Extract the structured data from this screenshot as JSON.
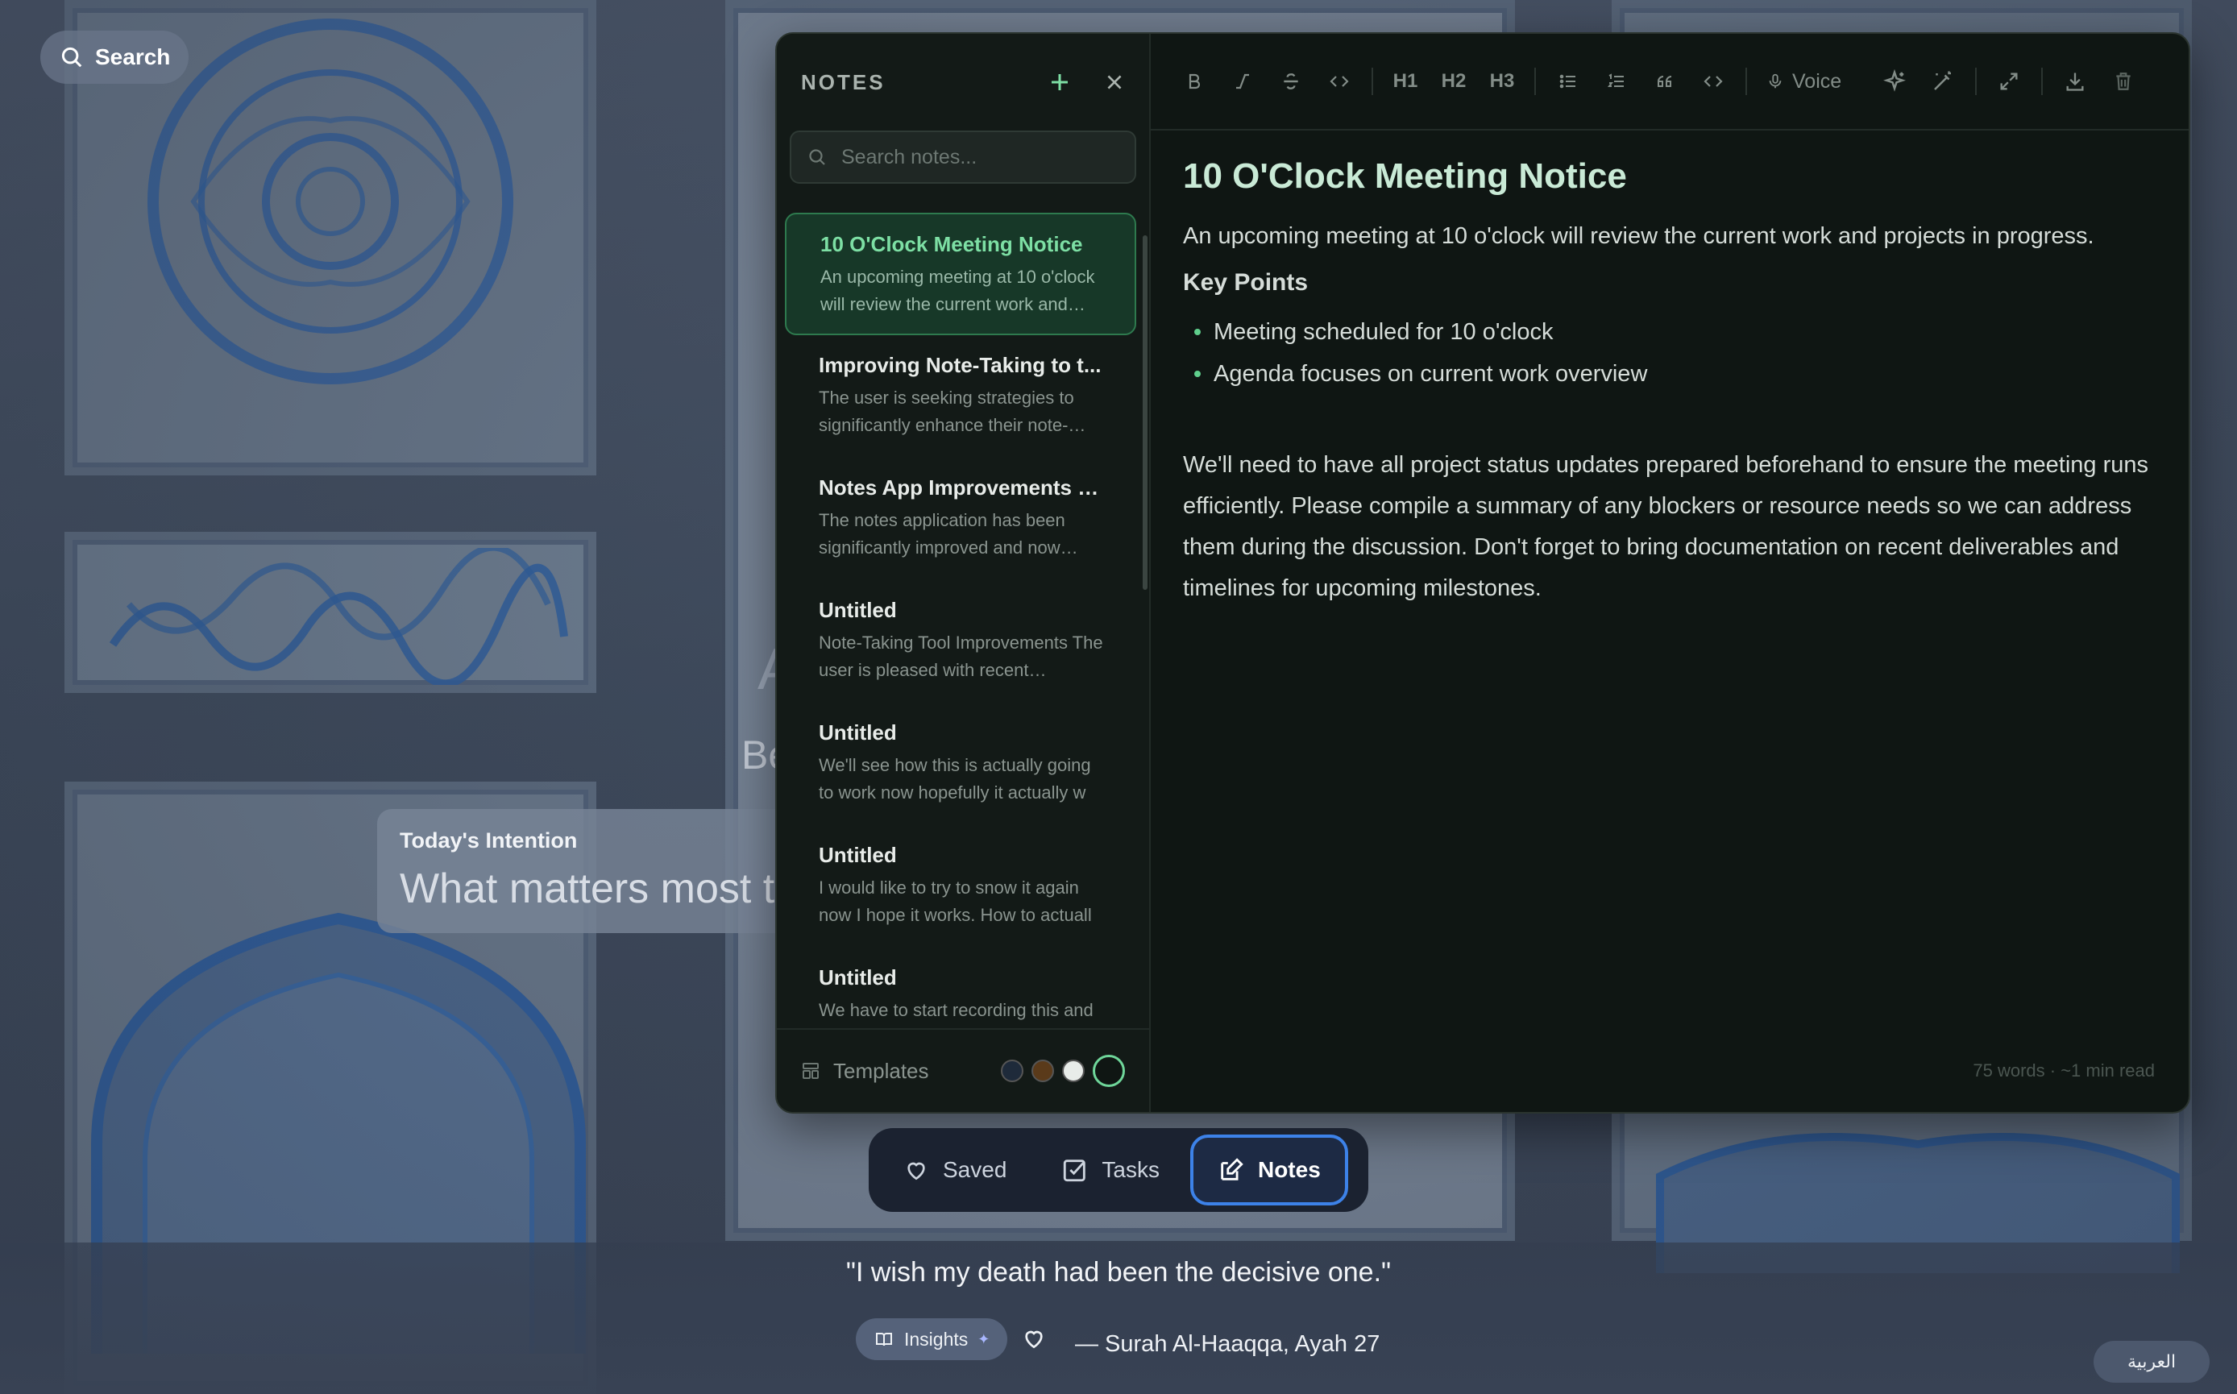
{
  "search": {
    "label": "Search"
  },
  "intention": {
    "label": "Today's Intention",
    "placeholder": "What matters most t"
  },
  "background_text": {
    "ghost_a": "A",
    "ghost_be": "Be"
  },
  "notes": {
    "title": "NOTES",
    "search_placeholder": "Search notes...",
    "items": [
      {
        "title": "10 O'Clock Meeting Notice",
        "preview": "An upcoming meeting at 10 o'clock will review the current work and…",
        "active": true
      },
      {
        "title": "Improving Note-Taking to t...",
        "preview": "The user is seeking strategies to significantly enhance their note-…"
      },
      {
        "title": "Notes App Improvements a...",
        "preview": "The notes application has been significantly improved and now…"
      },
      {
        "title": "Untitled",
        "preview": "Note-Taking Tool Improvements The user is pleased with recent…"
      },
      {
        "title": "Untitled",
        "preview": "We'll see how this is actually going to work now hopefully it actually w"
      },
      {
        "title": "Untitled",
        "preview": "I would like to try to snow it again now I hope it works. How to actuall"
      },
      {
        "title": "Untitled",
        "preview": "We have to start recording this and"
      }
    ],
    "templates_label": "Templates",
    "swatches": [
      "#1e2a3a",
      "#5a3a1a",
      "#e8ece9",
      "#0f1613"
    ],
    "toolbar": {
      "bold": "B",
      "italic": "I",
      "strike": "S",
      "code": "<>",
      "h1": "H1",
      "h2": "H2",
      "h3": "H3",
      "voice": "Voice"
    },
    "document": {
      "title": "10 O'Clock Meeting Notice",
      "intro": "An upcoming meeting at 10 o'clock will review the current work and projects in progress.",
      "section_heading": "Key Points",
      "bullets": [
        "Meeting scheduled for 10 o'clock",
        "Agenda focuses on current work overview"
      ],
      "paragraph": "We'll need to have all project status updates prepared beforehand to ensure the meeting runs efficiently. Please compile a summary of any blockers or resource needs so we can address them during the discussion. Don't forget to bring documentation on recent deliverables and timelines for upcoming milestones."
    },
    "word_count": "75 words · ~1 min read"
  },
  "bottom_nav": {
    "saved": "Saved",
    "tasks": "Tasks",
    "notes": "Notes",
    "active": "notes"
  },
  "quote": {
    "text": "\"I wish my death had been the decisive one.\"",
    "insights": "Insights",
    "source": "— Surah Al-Haaqqa, Ayah 27"
  },
  "language_button": "العربية",
  "colors": {
    "accent_green": "#7ddfa4",
    "active_nav_border": "#3d82e8",
    "window_bg": "#0f1613"
  }
}
